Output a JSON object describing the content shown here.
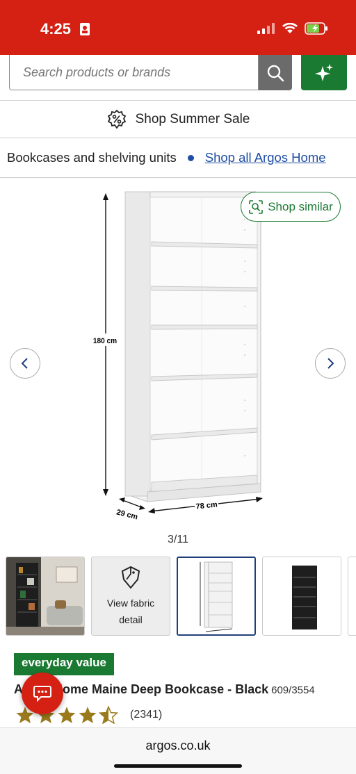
{
  "status_bar": {
    "time": "4:25"
  },
  "search": {
    "placeholder": "Search products or brands"
  },
  "promo": {
    "label": "Shop Summer Sale"
  },
  "breadcrumb": {
    "category": "Bookcases and shelving units",
    "link": "Shop all Argos Home"
  },
  "gallery": {
    "shop_similar": "Shop similar",
    "dimensions": {
      "height": "180 cm",
      "width": "78 cm",
      "depth": "29 cm"
    },
    "counter": "3/11",
    "thumbnails": [
      {
        "name": "room-scene"
      },
      {
        "name": "fabric-detail",
        "label_line1": "View fabric",
        "label_line2": "detail"
      },
      {
        "name": "dimensions",
        "active": true
      },
      {
        "name": "black-bookcase"
      }
    ]
  },
  "product": {
    "badge": "everyday value",
    "title": "Argos Home Maine Deep Bookcase - Black",
    "code": "609/3554",
    "rating_value": 4.5,
    "rating_count": "(2341)"
  },
  "browser": {
    "url": "argos.co.uk"
  },
  "colors": {
    "brand_red": "#d42114",
    "brand_green": "#1b7a32",
    "link_blue": "#1f4ea3"
  }
}
